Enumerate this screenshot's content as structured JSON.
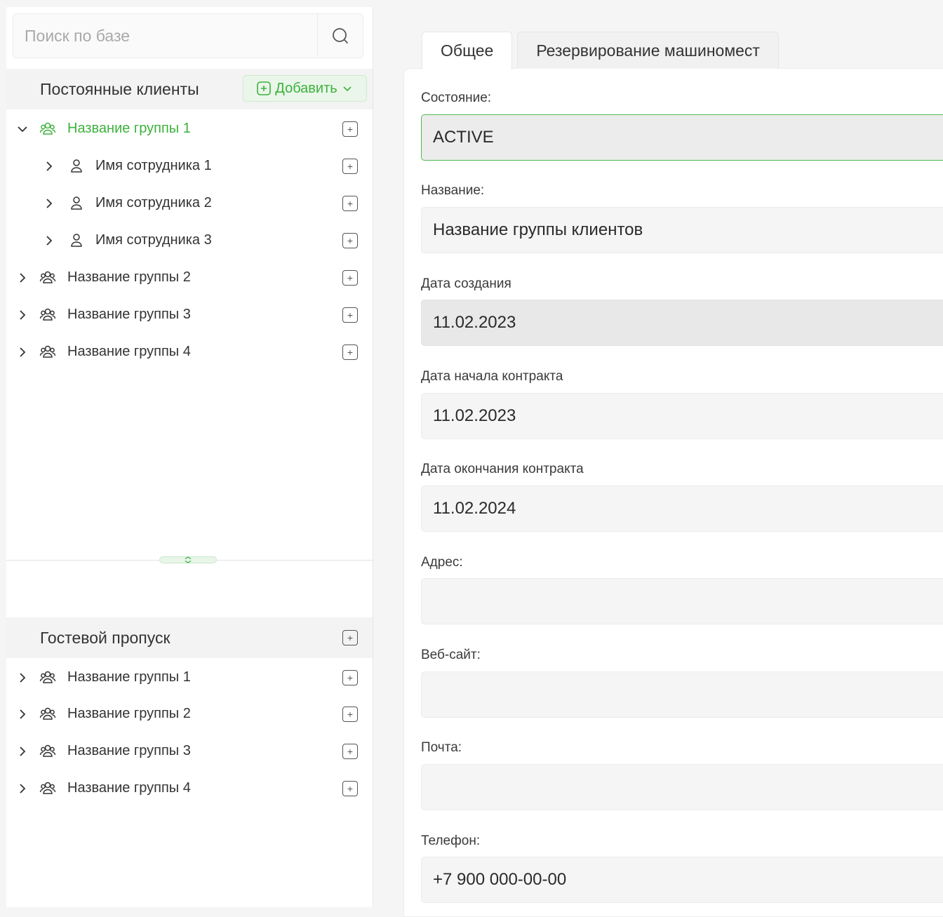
{
  "search": {
    "placeholder": "Поиск по базе"
  },
  "regular_clients": {
    "title": "Постоянные клиенты",
    "add_label": "Добавить",
    "tree": [
      {
        "label": "Название группы 1",
        "type": "group",
        "expanded": true,
        "active": true
      },
      {
        "label": "Имя сотрудника 1",
        "type": "person"
      },
      {
        "label": "Имя сотрудника 2",
        "type": "person"
      },
      {
        "label": "Имя сотрудника 3",
        "type": "person"
      },
      {
        "label": "Название группы 2",
        "type": "group"
      },
      {
        "label": "Название группы 3",
        "type": "group"
      },
      {
        "label": "Название группы 4",
        "type": "group"
      }
    ]
  },
  "guest_pass": {
    "title": "Гостевой пропуск",
    "tree": [
      {
        "label": "Название группы 1",
        "type": "group"
      },
      {
        "label": "Название группы 2",
        "type": "group"
      },
      {
        "label": "Название группы 3",
        "type": "group"
      },
      {
        "label": "Название группы 4",
        "type": "group"
      }
    ]
  },
  "tabs": [
    {
      "label": "Общее",
      "active": true
    },
    {
      "label": "Резервирование машиномест",
      "active": false
    }
  ],
  "form": {
    "status": {
      "label": "Состояние:",
      "value": "ACTIVE"
    },
    "name": {
      "label": "Название:",
      "value": "Название группы клиентов"
    },
    "created": {
      "label": "Дата создания",
      "value": "11.02.2023"
    },
    "contract_start": {
      "label": "Дата начала контракта",
      "value": "11.02.2023"
    },
    "contract_end": {
      "label": "Дата окончания контракта",
      "value": "11.02.2024"
    },
    "address": {
      "label": "Адрес:",
      "value": ""
    },
    "website": {
      "label": "Веб-сайт:",
      "value": ""
    },
    "email": {
      "label": "Почта:",
      "value": ""
    },
    "phone": {
      "label": "Телефон:",
      "value": "+7 900 000-00-00"
    }
  },
  "colors": {
    "accent": "#3db13d",
    "accent_bg": "#eaf6ea"
  }
}
